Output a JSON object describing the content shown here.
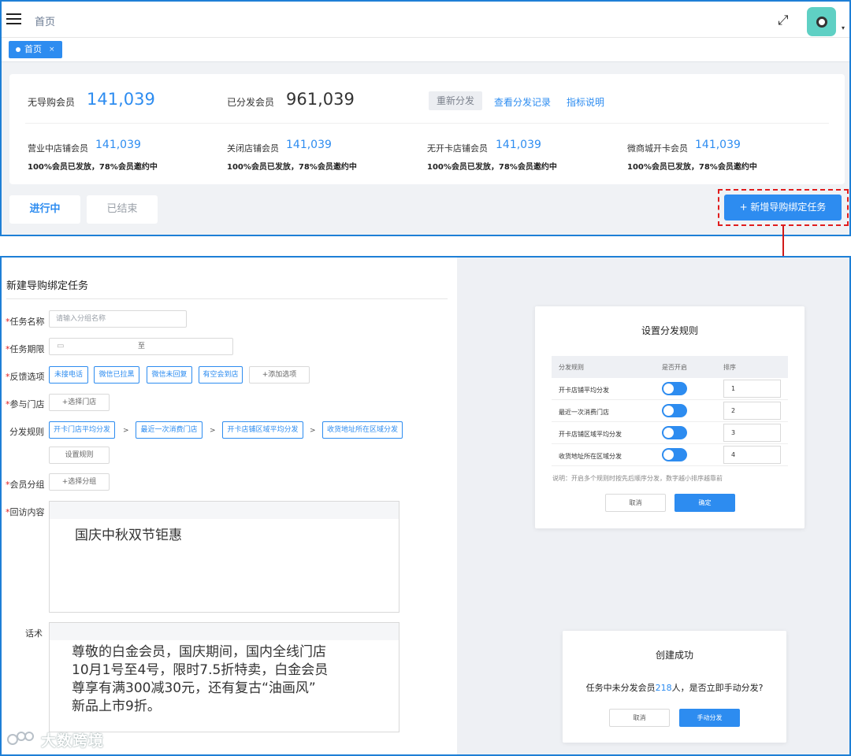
{
  "header": {
    "title": "首页",
    "tab_label": "首页",
    "tab_close": "×",
    "fullscreen_icon": "⤢",
    "caret": "▾"
  },
  "stats": {
    "no_guide_label": "无导购会员",
    "no_guide_value": "141,039",
    "distributed_label": "已分发会员",
    "distributed_value": "961,039",
    "redistribute": "重新分发",
    "view_records": "查看分发记录",
    "metric_desc": "指标说明",
    "items": [
      {
        "label": "营业中店铺会员",
        "value": "141,039",
        "desc": "100%会员已发放，78%会员邀约中"
      },
      {
        "label": "关闭店铺会员",
        "value": "141,039",
        "desc": "100%会员已发放，78%会员邀约中"
      },
      {
        "label": "无开卡店铺会员",
        "value": "141,039",
        "desc": "100%会员已发放，78%会员邀约中"
      },
      {
        "label": "微商城开卡会员",
        "value": "141,039",
        "desc": "100%会员已发放，78%会员邀约中"
      }
    ]
  },
  "status_tabs": {
    "ongoing": "进行中",
    "ended": "已结束"
  },
  "add_task_button": "+ 新增导购绑定任务",
  "form": {
    "title": "新建导购绑定任务",
    "required_mark": "*",
    "task_name_label": "任务名称",
    "task_name_placeholder": "请输入分组名称",
    "period_label": "任务期限",
    "period_to": "至",
    "feedback_label": "反馈选项",
    "feedback_options": [
      "未接电话",
      "微信已拉黑",
      "微信未回复",
      "有空会到店"
    ],
    "feedback_add": "+添加选项",
    "stores_label": "参与门店",
    "stores_select": "+选择门店",
    "rules_label": "分发规则",
    "rules": [
      "开卡门店平均分发",
      "最近一次消费门店",
      "开卡店铺区域平均分发",
      "收货地址所在区域分发"
    ],
    "rules_sep": ">",
    "rules_setting": "设置规则",
    "group_label": "会员分组",
    "group_select": "+选择分组",
    "visit_label": "回访内容",
    "visit_content": "国庆中秋双节钜惠",
    "script_label": "话术",
    "script_lines": [
      "尊敬的白金会员，国庆期间，国内全线门店",
      "10月1号至4号，限时7.5折特卖，白金会员",
      "尊享有满300减30元，还有复古“油画风”",
      "新品上市9折。"
    ]
  },
  "rule_dialog": {
    "title": "设置分发规则",
    "col_rule": "分发规则",
    "col_enabled": "是否开启",
    "col_order": "排序",
    "rows": [
      {
        "name": "开卡店铺平均分发",
        "order": "1"
      },
      {
        "name": "最近一次消费门店",
        "order": "2"
      },
      {
        "name": "开卡店铺区域平均分发",
        "order": "3"
      },
      {
        "name": "收货地址所在区域分发",
        "order": "4"
      }
    ],
    "note": "说明：开启多个规则时按先后顺序分发，数字越小排序越靠前",
    "cancel": "取消",
    "confirm": "确定"
  },
  "success_dialog": {
    "title": "创建成功",
    "msg_before": "任务中未分发会员",
    "msg_count": "218",
    "msg_after": "人，是否立即手动分发?",
    "cancel": "取消",
    "manual": "手动分发"
  },
  "watermark": "大数跨境",
  "colors": {
    "accent": "#2d8cf0",
    "frame": "#1e7fd6",
    "highlight": "#e01d1d"
  }
}
